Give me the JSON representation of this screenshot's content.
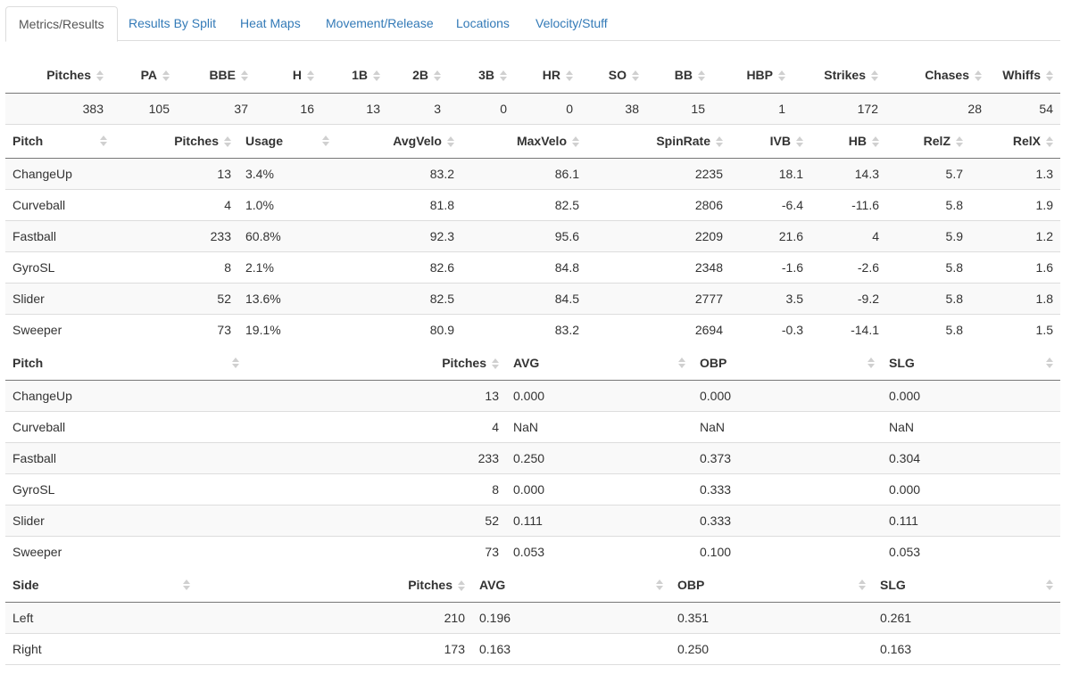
{
  "tabs": [
    "Metrics/Results",
    "Results By Split",
    "Heat Maps",
    "Movement/Release",
    "Locations",
    "Velocity/Stuff"
  ],
  "summary": {
    "headers": [
      "Pitches",
      "PA",
      "BBE",
      "H",
      "1B",
      "2B",
      "3B",
      "HR",
      "SO",
      "BB",
      "HBP",
      "Strikes",
      "Chases",
      "Whiffs"
    ],
    "values": [
      "383",
      "105",
      "37",
      "16",
      "13",
      "3",
      "0",
      "0",
      "38",
      "15",
      "1",
      "172",
      "28",
      "54"
    ]
  },
  "metrics": {
    "headers": [
      "Pitch",
      "Pitches",
      "Usage",
      "AvgVelo",
      "MaxVelo",
      "SpinRate",
      "IVB",
      "HB",
      "RelZ",
      "RelX"
    ],
    "rows": [
      [
        "ChangeUp",
        "13",
        "3.4%",
        "83.2",
        "86.1",
        "2235",
        "18.1",
        "14.3",
        "5.7",
        "1.3"
      ],
      [
        "Curveball",
        "4",
        "1.0%",
        "81.8",
        "82.5",
        "2806",
        "-6.4",
        "-11.6",
        "5.8",
        "1.9"
      ],
      [
        "Fastball",
        "233",
        "60.8%",
        "92.3",
        "95.6",
        "2209",
        "21.6",
        "4",
        "5.9",
        "1.2"
      ],
      [
        "GyroSL",
        "8",
        "2.1%",
        "82.6",
        "84.8",
        "2348",
        "-1.6",
        "-2.6",
        "5.8",
        "1.6"
      ],
      [
        "Slider",
        "52",
        "13.6%",
        "82.5",
        "84.5",
        "2777",
        "3.5",
        "-9.2",
        "5.8",
        "1.8"
      ],
      [
        "Sweeper",
        "73",
        "19.1%",
        "80.9",
        "83.2",
        "2694",
        "-0.3",
        "-14.1",
        "5.8",
        "1.5"
      ]
    ]
  },
  "pitch_results": {
    "headers": [
      "Pitch",
      "Pitches",
      "AVG",
      "OBP",
      "SLG"
    ],
    "rows": [
      [
        "ChangeUp",
        "13",
        "0.000",
        "0.000",
        "0.000"
      ],
      [
        "Curveball",
        "4",
        "NaN",
        "NaN",
        "NaN"
      ],
      [
        "Fastball",
        "233",
        "0.250",
        "0.373",
        "0.304"
      ],
      [
        "GyroSL",
        "8",
        "0.000",
        "0.333",
        "0.000"
      ],
      [
        "Slider",
        "52",
        "0.111",
        "0.333",
        "0.111"
      ],
      [
        "Sweeper",
        "73",
        "0.053",
        "0.100",
        "0.053"
      ]
    ]
  },
  "side_results": {
    "headers": [
      "Side",
      "Pitches",
      "AVG",
      "OBP",
      "SLG"
    ],
    "rows": [
      [
        "Left",
        "210",
        "0.196",
        "0.351",
        "0.261"
      ],
      [
        "Right",
        "173",
        "0.163",
        "0.250",
        "0.163"
      ]
    ]
  }
}
